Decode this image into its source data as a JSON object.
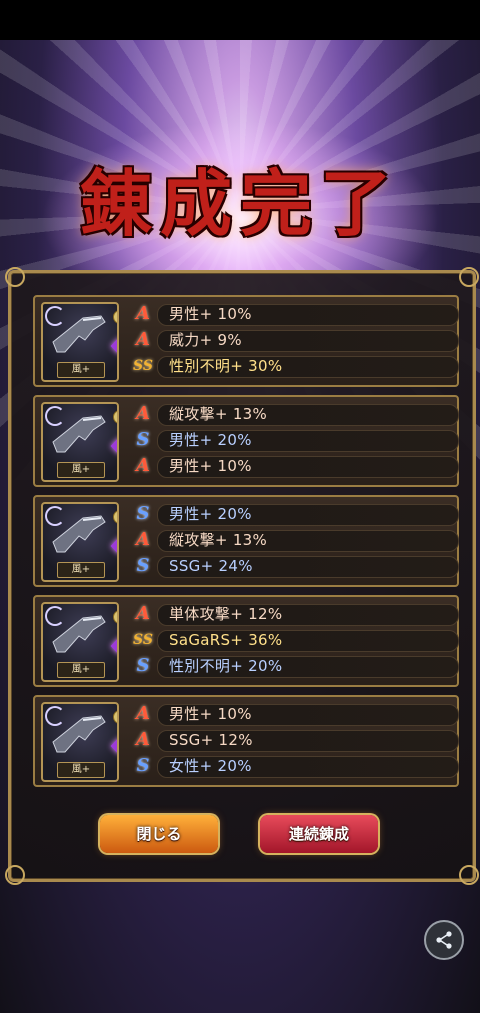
{
  "title": "錬成完了",
  "cards": [
    {
      "tag": "風+",
      "rows": [
        {
          "grade": "A",
          "grade_label": "A",
          "text": "男性+ 10%"
        },
        {
          "grade": "A",
          "grade_label": "A",
          "text": "威力+ 9%"
        },
        {
          "grade": "SS",
          "grade_label": "SS",
          "text": "性別不明+ 30%"
        }
      ]
    },
    {
      "tag": "風+",
      "rows": [
        {
          "grade": "A",
          "grade_label": "A",
          "text": "縦攻撃+ 13%"
        },
        {
          "grade": "S",
          "grade_label": "S",
          "text": "男性+ 20%"
        },
        {
          "grade": "A",
          "grade_label": "A",
          "text": "男性+ 10%"
        }
      ]
    },
    {
      "tag": "風+",
      "rows": [
        {
          "grade": "S",
          "grade_label": "S",
          "text": "男性+ 20%"
        },
        {
          "grade": "A",
          "grade_label": "A",
          "text": "縦攻撃+ 13%"
        },
        {
          "grade": "S",
          "grade_label": "S",
          "text": "SSG+ 24%"
        }
      ]
    },
    {
      "tag": "風+",
      "rows": [
        {
          "grade": "A",
          "grade_label": "A",
          "text": "単体攻撃+ 12%"
        },
        {
          "grade": "SS",
          "grade_label": "SS",
          "text": "SaGaRS+ 36%"
        },
        {
          "grade": "S",
          "grade_label": "S",
          "text": "性別不明+ 20%"
        }
      ]
    },
    {
      "tag": "風+",
      "rows": [
        {
          "grade": "A",
          "grade_label": "A",
          "text": "男性+ 10%"
        },
        {
          "grade": "A",
          "grade_label": "A",
          "text": "SSG+ 12%"
        },
        {
          "grade": "S",
          "grade_label": "S",
          "text": "女性+ 20%"
        }
      ]
    }
  ],
  "buttons": {
    "close": "閉じる",
    "continue": "連続錬成"
  },
  "icons": {
    "share": "share-icon",
    "weapon": "pistol-icon",
    "gem": "gem-icon",
    "medal": "medal-icon"
  }
}
